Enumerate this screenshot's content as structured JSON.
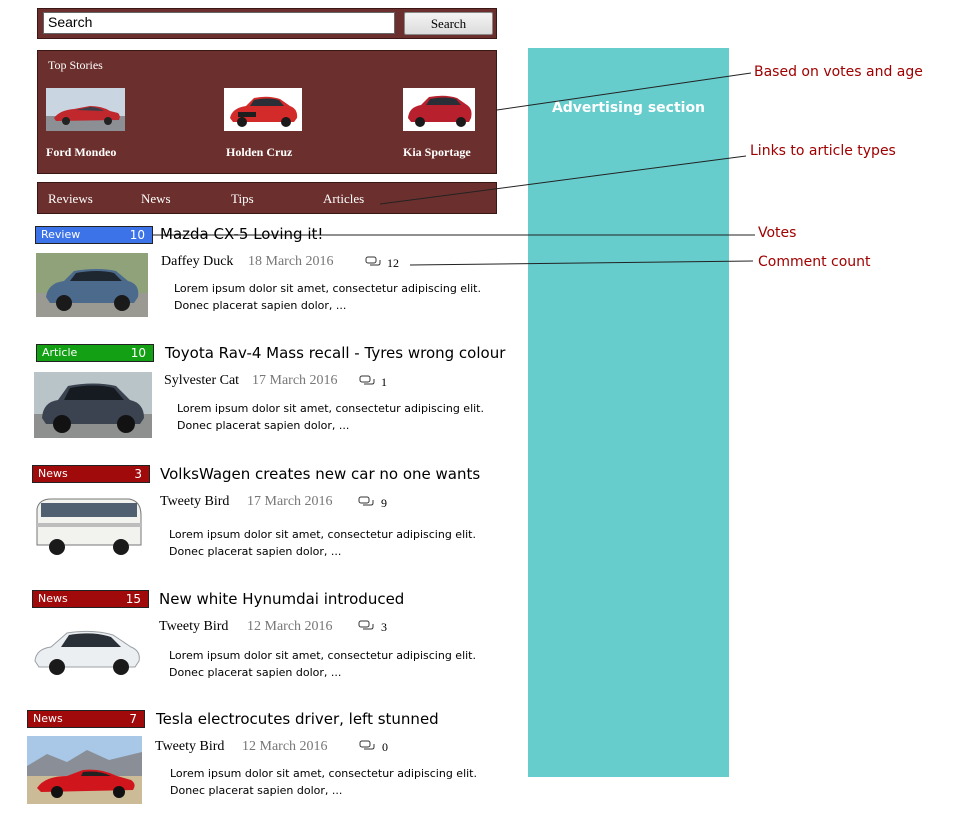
{
  "search": {
    "value": "Search",
    "button_label": "Search"
  },
  "top_stories": {
    "label": "Top Stories",
    "items": [
      {
        "name": "Ford Mondeo",
        "color": "#c0282d"
      },
      {
        "name": "Holden Cruz",
        "color": "#d32a2a"
      },
      {
        "name": "Kia Sportage",
        "color": "#b8202e"
      }
    ]
  },
  "nav": {
    "items": [
      "Reviews",
      "News",
      "Tips",
      "Articles"
    ]
  },
  "ad": {
    "label": "Advertising section"
  },
  "annotations": {
    "votes_age": "Based on votes and age",
    "links": "Links to article types",
    "votes": "Votes",
    "comment_count": "Comment count"
  },
  "articles": [
    {
      "type": "Review",
      "votes": "10",
      "color": "#3d73e8",
      "title": "Mazda CX-5 Loving it!",
      "author": "Daffey Duck",
      "date": "18 March 2016",
      "comments": "12",
      "excerpt_1": "Lorem ipsum dolor sit amet, consectetur adipiscing elit.",
      "excerpt_2": "Donec placerat sapien dolor, ..."
    },
    {
      "type": "Article",
      "votes": "10",
      "color": "#13a014",
      "title": "Toyota Rav-4 Mass recall - Tyres wrong colour",
      "author": "Sylvester Cat",
      "date": "17 March 2016",
      "comments": "1",
      "excerpt_1": "Lorem ipsum dolor sit amet, consectetur adipiscing elit.",
      "excerpt_2": "Donec placerat sapien dolor, ..."
    },
    {
      "type": "News",
      "votes": "3",
      "color": "#a00a0a",
      "title": "VolksWagen creates new car no one wants",
      "author": "Tweety Bird",
      "date": "17 March 2016",
      "comments": "9",
      "excerpt_1": "Lorem ipsum dolor sit amet, consectetur adipiscing elit.",
      "excerpt_2": "Donec placerat sapien dolor, ..."
    },
    {
      "type": "News",
      "votes": "15",
      "color": "#a00a0a",
      "title": "New white Hynumdai introduced",
      "author": "Tweety Bird",
      "date": "12 March 2016",
      "comments": "3",
      "excerpt_1": "Lorem ipsum dolor sit amet, consectetur adipiscing elit.",
      "excerpt_2": "Donec placerat sapien dolor, ..."
    },
    {
      "type": "News",
      "votes": "7",
      "color": "#a00a0a",
      "title": "Tesla electrocutes driver, left stunned",
      "author": "Tweety Bird",
      "date": "12 March 2016",
      "comments": "0",
      "excerpt_1": "Lorem ipsum dolor sit amet, consectetur adipiscing elit.",
      "excerpt_2": "Donec placerat sapien dolor, ..."
    }
  ]
}
